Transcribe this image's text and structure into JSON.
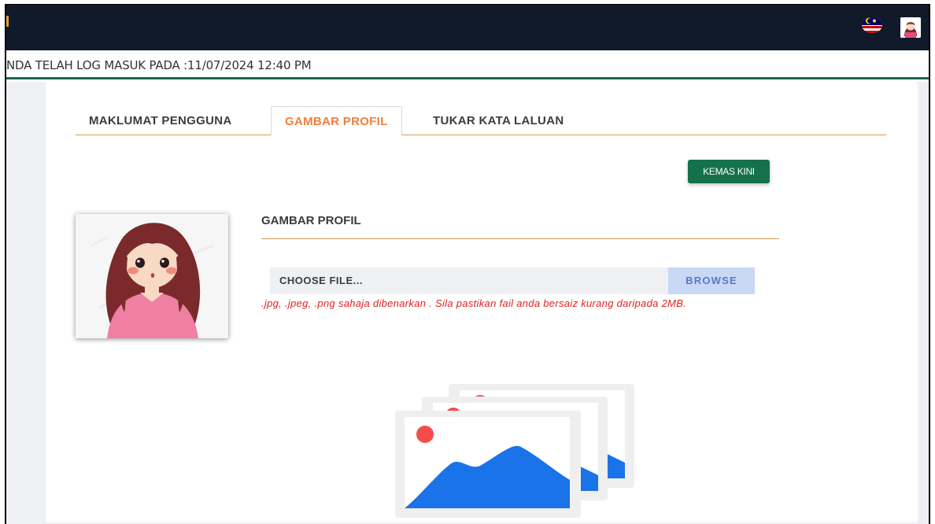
{
  "login_info": "NDA TELAH LOG MASUK PADA :11/07/2024 12:40 PM",
  "tabs": [
    {
      "label": "MAKLUMAT PENGGUNA",
      "active": false
    },
    {
      "label": "GAMBAR PROFIL",
      "active": true
    },
    {
      "label": "TUKAR KATA LALUAN",
      "active": false
    }
  ],
  "update_button": "KEMAS KINI",
  "section": {
    "title": "GAMBAR PROFIL"
  },
  "file_input": {
    "placeholder": "CHOOSE FILE...",
    "browse_label": "BROWSE"
  },
  "hint": ".jpg, .jpeg, .png sahaja dibenarkan . Sila pastikan fail anda bersaiz kurang daripada 2MB.",
  "icons": {
    "flag": "malaysia-flag-icon",
    "user_avatar": "user-avatar-icon",
    "placeholder": "image-placeholder-icon"
  },
  "colors": {
    "topbar": "#111a2b",
    "accent_green": "#14714a",
    "active_tab": "#f07f3a",
    "tab_line": "#d59b52",
    "hint_red": "#e32020",
    "browse_bg": "#c8d8f5",
    "image_blue": "#1a73e8"
  }
}
